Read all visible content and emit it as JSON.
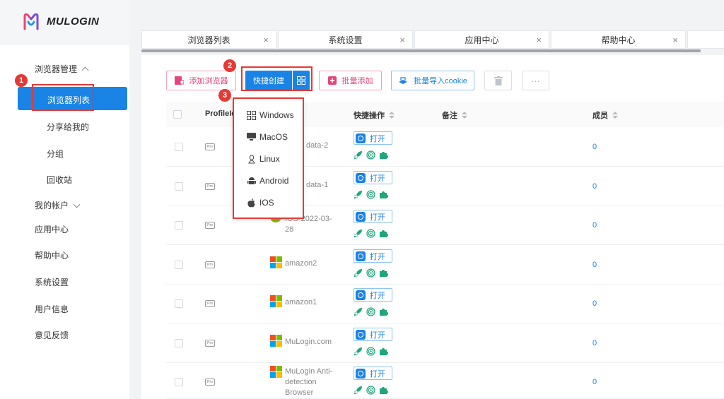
{
  "app": {
    "logo_text": "MULOGIN"
  },
  "sidebar": {
    "browser_mgmt": "浏览器管理",
    "browser_list": "浏览器列表",
    "shared_with_me": "分享给我的",
    "groups": "分组",
    "recycle_bin": "回收站",
    "my_account": "我的帐户",
    "app_center": "应用中心",
    "help_center": "帮助中心",
    "system_settings": "系统设置",
    "user_info": "用户信息",
    "feedback": "意见反馈"
  },
  "tabs": [
    {
      "label": "浏览器列表"
    },
    {
      "label": "系统设置"
    },
    {
      "label": "应用中心"
    },
    {
      "label": "帮助中心"
    }
  ],
  "tab_close_glyph": "×",
  "toolbar": {
    "add_browser": "添加浏览器",
    "quick_create": "快捷创建",
    "batch_add": "批量添加",
    "batch_import_cookie": "批量导入cookie",
    "more": "···"
  },
  "badges": {
    "one": "1",
    "two": "2",
    "three": "3"
  },
  "dropdown": {
    "items": [
      {
        "label": "Windows",
        "icon": "windows-icon"
      },
      {
        "label": "MacOS",
        "icon": "macos-icon"
      },
      {
        "label": "Linux",
        "icon": "linux-icon"
      },
      {
        "label": "Android",
        "icon": "android-icon"
      },
      {
        "label": "IOS",
        "icon": "ios-icon"
      }
    ]
  },
  "table": {
    "columns": {
      "profile_id": "ProfileId",
      "quick_ops": "快捷操作",
      "notes": "备注",
      "members": "成员"
    },
    "pro_label": "Pro",
    "open_label": "打开",
    "rows": [
      {
        "name": "data-2",
        "members": "0"
      },
      {
        "name": "data-1",
        "members": "0"
      },
      {
        "name": "IOS-2022-03-28",
        "members": "0"
      },
      {
        "name": "amazon2",
        "members": "0"
      },
      {
        "name": "amazon1",
        "members": "0"
      },
      {
        "name": "MuLogin.com",
        "members": "0"
      },
      {
        "name": "MuLogin Anti-detection Browser",
        "members": "0"
      }
    ]
  }
}
